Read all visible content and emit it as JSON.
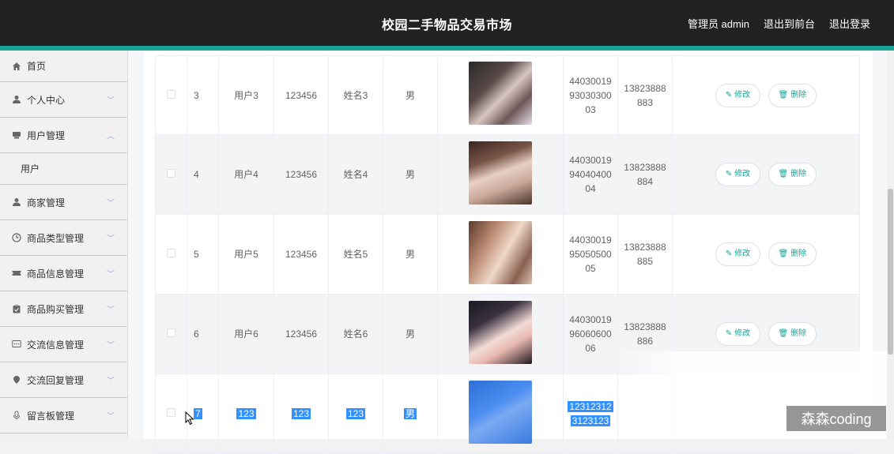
{
  "header": {
    "title": "校园二手物品交易市场",
    "admin_label": "管理员 admin",
    "front_label": "退出到前台",
    "logout_label": "退出登录"
  },
  "sidebar": {
    "items": [
      {
        "label": "首页",
        "icon": "home-icon"
      },
      {
        "label": "个人中心",
        "icon": "user-icon"
      },
      {
        "label": "用户管理",
        "icon": "users-icon",
        "expanded": true,
        "children": [
          "用户"
        ]
      },
      {
        "label": "商家管理",
        "icon": "shop-icon"
      },
      {
        "label": "商品类型管理",
        "icon": "clock-icon"
      },
      {
        "label": "商品信息管理",
        "icon": "ticket-icon"
      },
      {
        "label": "商品购买管理",
        "icon": "clipboard-icon"
      },
      {
        "label": "交流信息管理",
        "icon": "chat-icon"
      },
      {
        "label": "交流回复管理",
        "icon": "pin-icon"
      },
      {
        "label": "留言板管理",
        "icon": "mic-icon"
      }
    ]
  },
  "table": {
    "rows": [
      {
        "no": "3",
        "account": "用户3",
        "password": "123456",
        "name": "姓名3",
        "gender": "男",
        "id_line1": "44030019",
        "id_line2": "93030300",
        "id_line3": "03",
        "phone_line1": "13823888",
        "phone_line2": "883"
      },
      {
        "no": "4",
        "account": "用户4",
        "password": "123456",
        "name": "姓名4",
        "gender": "男",
        "id_line1": "44030019",
        "id_line2": "94040400",
        "id_line3": "04",
        "phone_line1": "13823888",
        "phone_line2": "884"
      },
      {
        "no": "5",
        "account": "用户5",
        "password": "123456",
        "name": "姓名5",
        "gender": "男",
        "id_line1": "44030019",
        "id_line2": "95050500",
        "id_line3": "05",
        "phone_line1": "13823888",
        "phone_line2": "885"
      },
      {
        "no": "6",
        "account": "用户6",
        "password": "123456",
        "name": "姓名6",
        "gender": "男",
        "id_line1": "44030019",
        "id_line2": "96060600",
        "id_line3": "06",
        "phone_line1": "13823888",
        "phone_line2": "886"
      },
      {
        "no": "7",
        "account": "123",
        "password": "123",
        "name": "123",
        "gender": "男",
        "id_line1": "12312312",
        "id_line2": "3123123"
      }
    ],
    "edit_label": "修改",
    "delete_label": "删除"
  },
  "watermark": "森森coding",
  "colors": {
    "accent": "#17a398",
    "topbar": "#212322",
    "selection": "#3390ff"
  }
}
